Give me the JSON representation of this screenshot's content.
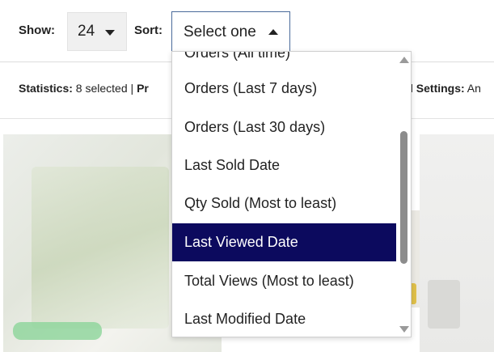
{
  "toolbar": {
    "show_label": "Show:",
    "show_value": "24",
    "sort_label": "Sort:",
    "sort_value": "Select one"
  },
  "stats": {
    "left_label": "Statistics:",
    "left_value": " 8 selected | ",
    "left_cut": "Pr",
    "right_label": "l Settings:",
    "right_value": " An"
  },
  "dropdown": {
    "options": [
      "Orders (All time)",
      "Orders (Last 7 days)",
      "Orders (Last 30 days)",
      "Last Sold Date",
      "Qty Sold (Most to least)",
      "Last Viewed Date",
      "Total Views (Most to least)",
      "Last Modified Date"
    ],
    "selected_index": 5
  },
  "colors": {
    "selected_bg": "#0c0a5e",
    "tag_green": "#8cd49a"
  }
}
